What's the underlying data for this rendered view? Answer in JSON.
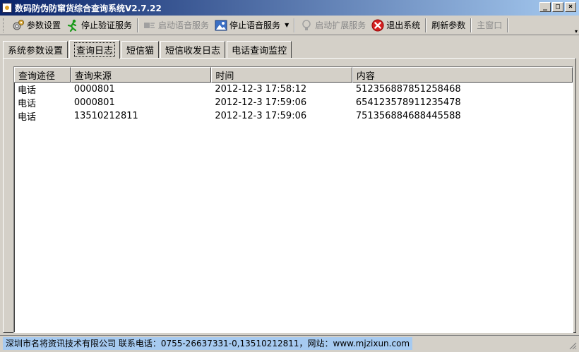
{
  "window": {
    "title": "数码防伪防窜货综合查询系统V2.7.22",
    "min_label": "_",
    "max_label": "□",
    "close_label": "×"
  },
  "toolbar": {
    "params_label": "参数设置",
    "stop_verify_label": "停止验证服务",
    "start_voice_label": "启动语音服务",
    "stop_voice_label": "停止语音服务",
    "start_ext_label": "启动扩展服务",
    "exit_label": "退出系统",
    "refresh_label": "刷新参数",
    "main_window_label": "主窗口"
  },
  "tabs": [
    {
      "label": "系统参数设置"
    },
    {
      "label": "查询日志"
    },
    {
      "label": "短信猫"
    },
    {
      "label": "短信收发日志"
    },
    {
      "label": "电话查询监控"
    }
  ],
  "active_tab": 1,
  "table": {
    "columns": [
      "查询途径",
      "查询来源",
      "时间",
      "内容"
    ],
    "rows": [
      [
        "电话",
        "0000801",
        "2012-12-3 17:58:12",
        "512356887851258468"
      ],
      [
        "电话",
        "0000801",
        "2012-12-3 17:59:06",
        "654123578911235478"
      ],
      [
        "电话",
        "13510212811",
        "2012-12-3 17:59:06",
        "751356884688445588"
      ]
    ]
  },
  "status": {
    "text": "深圳市名将资讯技术有限公司 联系电话：0755-26637331-0,13510212811，网站：www.mjzixun.com"
  },
  "colors": {
    "title_start": "#0a246a",
    "title_end": "#a6caf0",
    "face": "#d4d0c8",
    "status_highlight": "#a6caf0",
    "exit_red": "#d42020",
    "go_green": "#1a9a1a"
  }
}
